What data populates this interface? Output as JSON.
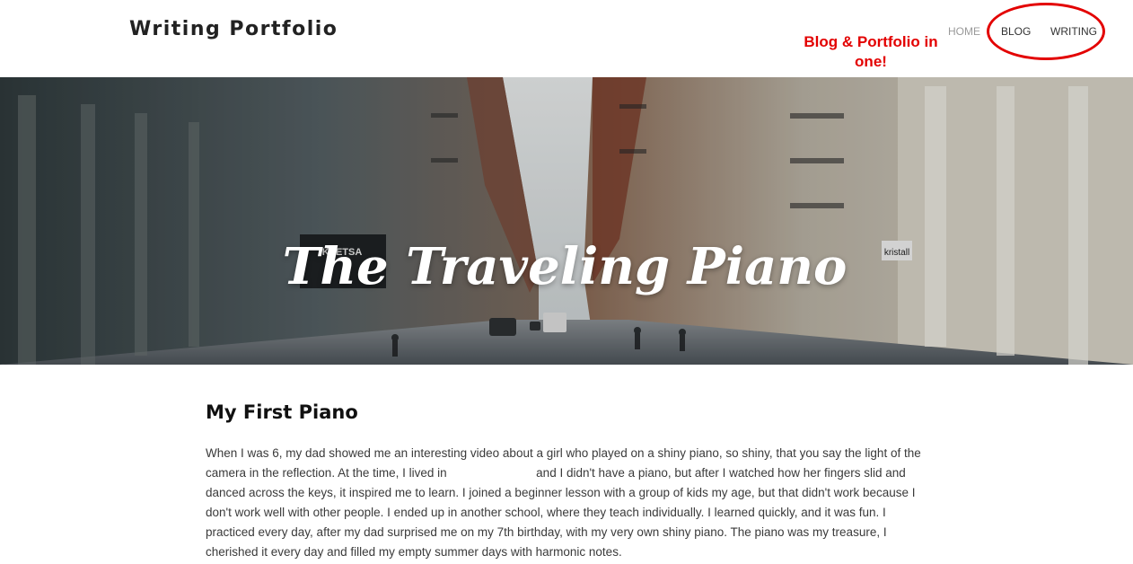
{
  "header": {
    "site_title": "Writing Portfolio",
    "nav": {
      "home": "HOME",
      "blog": "BLOG",
      "writing": "WRITING"
    },
    "annotation_text": "Blog & Portfolio in one!"
  },
  "hero": {
    "title": "The Traveling Piano",
    "sign_keetsa": "KEETSA",
    "sign_kristall": "kristall"
  },
  "post": {
    "title": "My First Piano",
    "body_part1": "When I was 6, my dad showed me an interesting video about a girl who played on a shiny piano, so shiny, that you say the light of the camera in the reflection. At the time, I lived in",
    "body_part2": "and I didn't have a piano, but after I watched how her fingers slid and danced across the keys, it inspired me to learn. I joined a beginner lesson with a group of kids my age, but that didn't work because I don't work well with other people. I ended up in another school, where they teach individually. I learned quickly, and it was fun. I practiced every day, after my dad surprised me on my 7th birthday, with my very own shiny piano. The piano was my treasure, I cherished it every day and filled my empty summer days with harmonic notes."
  },
  "colors": {
    "annotation": "#e30000",
    "nav_active": "#333333",
    "nav_muted": "#9a9a9a",
    "body_text": "#3a3a3a"
  }
}
